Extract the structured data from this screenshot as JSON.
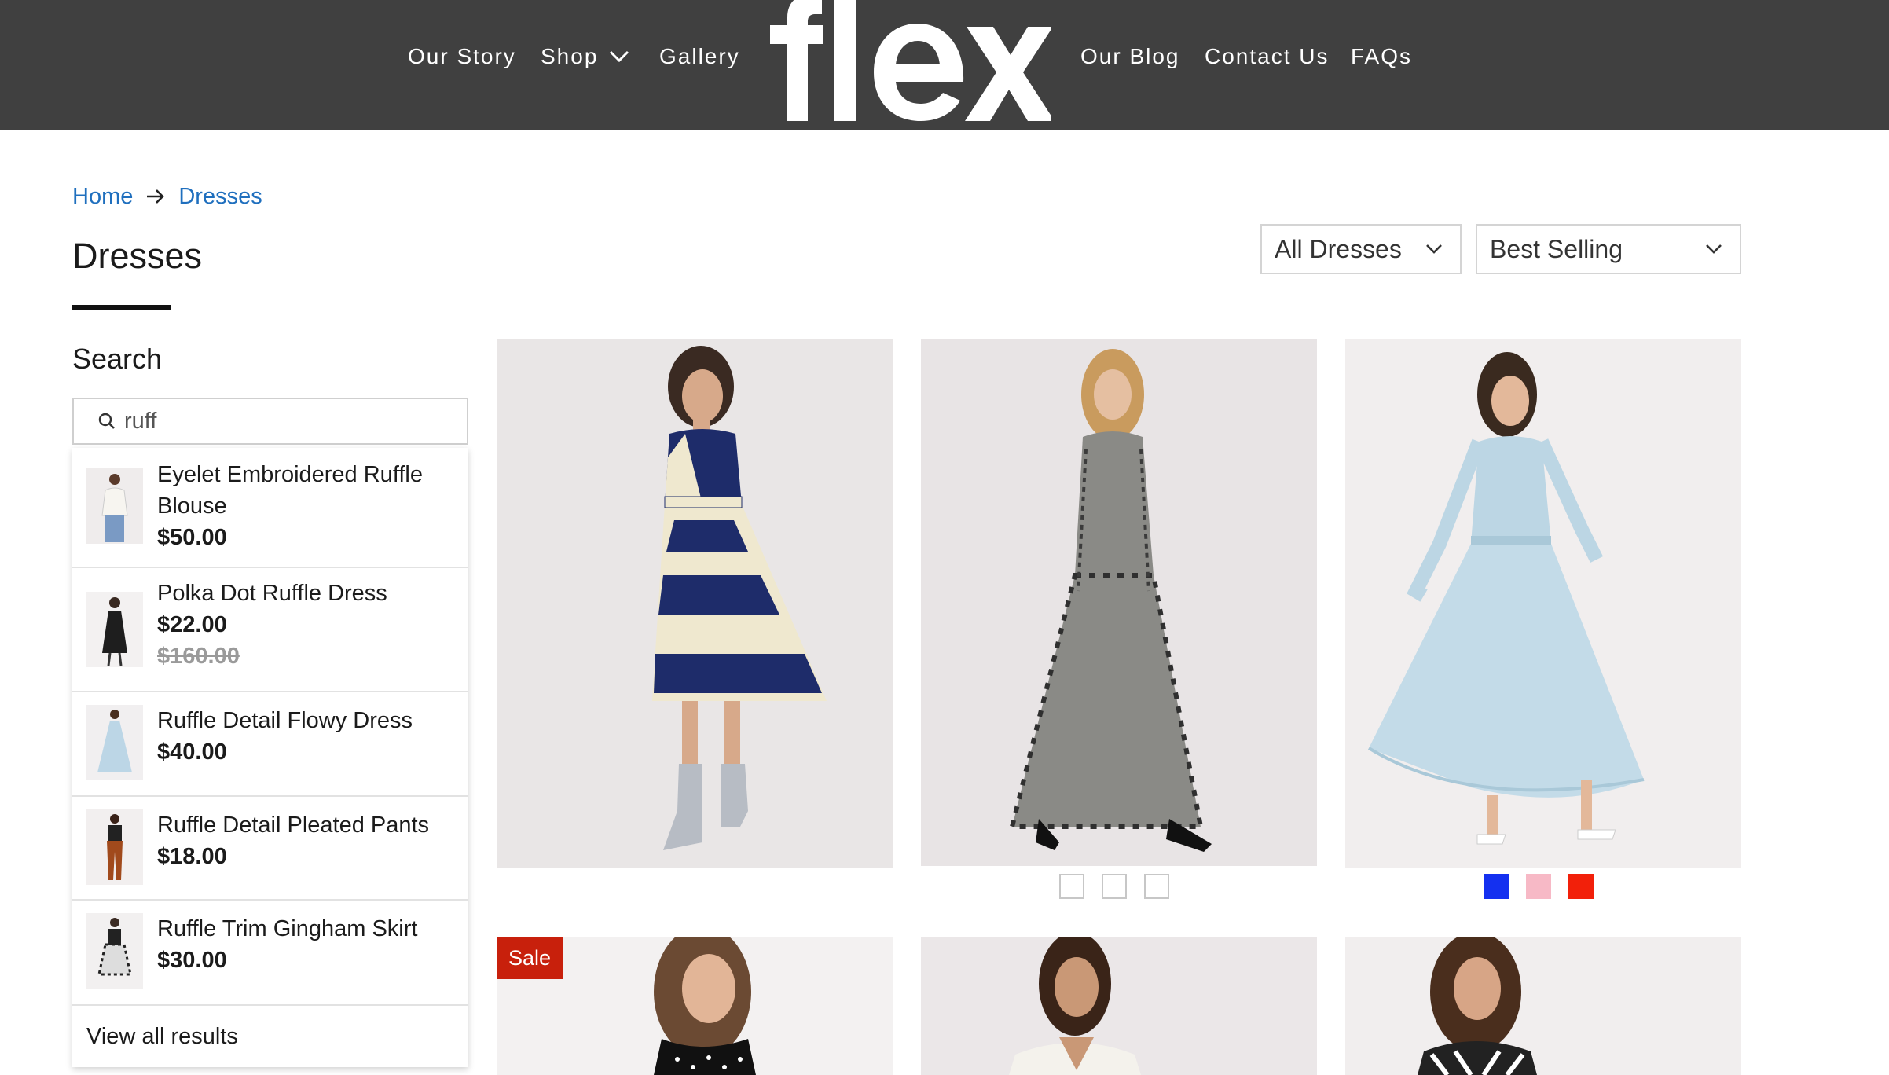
{
  "header": {
    "nav_left": [
      "Our Story",
      "Shop",
      "Gallery"
    ],
    "nav_right": [
      "Our Blog",
      "Contact Us",
      "FAQs"
    ],
    "logo_text": "flex"
  },
  "breadcrumb": {
    "home": "Home",
    "current": "Dresses"
  },
  "page_title": "Dresses",
  "filters": {
    "category": "All Dresses",
    "sort": "Best Selling"
  },
  "search": {
    "heading": "Search",
    "query": "ruff",
    "results": [
      {
        "title": "Eyelet Embroidered Ruffle Blouse",
        "price": "$50.00",
        "old_price": ""
      },
      {
        "title": "Polka Dot Ruffle Dress",
        "price": "$22.00",
        "old_price": "$160.00"
      },
      {
        "title": "Ruffle Detail Flowy Dress",
        "price": "$40.00",
        "old_price": ""
      },
      {
        "title": "Ruffle Detail Pleated Pants",
        "price": "$18.00",
        "old_price": ""
      },
      {
        "title": "Ruffle Trim Gingham Skirt",
        "price": "$30.00",
        "old_price": ""
      }
    ],
    "view_all": "View all results"
  },
  "products": {
    "badge": "Sale",
    "swatches_2": [
      "#ffffff",
      "#ffffff",
      "#ffffff"
    ],
    "swatches_3": [
      "#1430f0",
      "#f7b9c6",
      "#f2200a"
    ]
  },
  "colors": {
    "header_bg": "#404040",
    "link": "#1f6fbe",
    "sale": "#c8200c"
  }
}
